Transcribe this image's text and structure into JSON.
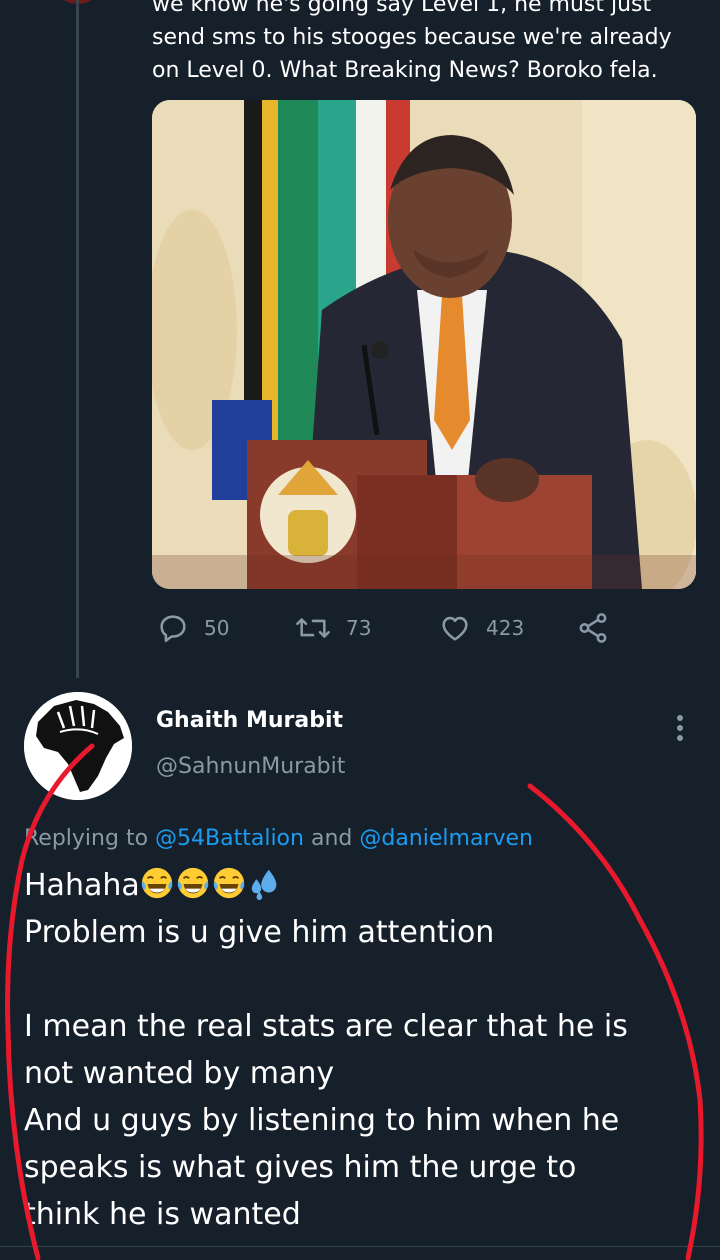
{
  "previous_tweet": {
    "text_lines": [
      "we know he's going say Level 1, he must just",
      "send sms to his stooges because we're already",
      "on Level 0. What Breaking News? Boroko fela."
    ],
    "photo_icon": "press-conference-photo",
    "actions": {
      "reply_count": "50",
      "retweet_count": "73",
      "like_count": "423"
    }
  },
  "reply": {
    "display_name": "Ghaith Murabit",
    "handle": "@SahnunMurabit",
    "replying_prefix": "Replying to ",
    "mention_1": "@54Battalion",
    "replying_and": " and ",
    "mention_2": "@danielmarven",
    "body_line_1": "Hahaha",
    "body_line_2": "Problem is u give him attention",
    "body_line_3": "",
    "body_line_4": "I mean the real stats are clear that he is",
    "body_line_5": "not wanted by many",
    "body_line_6": "And u guys by listening to him when he",
    "body_line_7": "speaks is what gives him the urge to",
    "body_line_8": "think he is wanted"
  },
  "colors": {
    "background": "#15202b",
    "muted_text": "#8b98a5",
    "mention_blue": "#1d9bf0",
    "annotation_red": "#e8192c"
  }
}
